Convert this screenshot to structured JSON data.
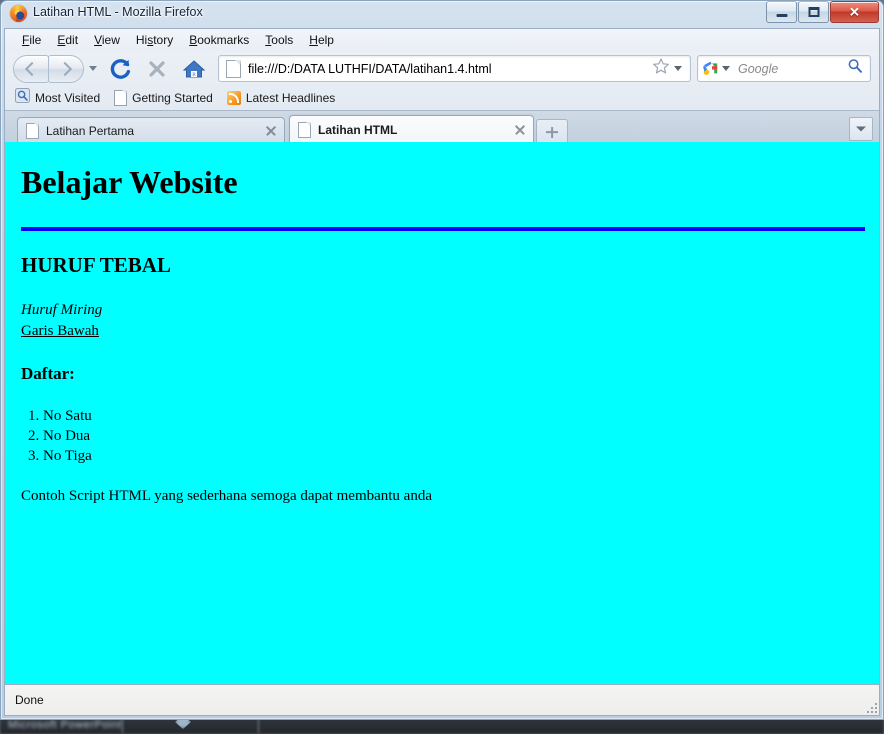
{
  "window": {
    "title": "Latihan HTML - Mozilla Firefox",
    "icon": "firefox-logo-icon",
    "controls": {
      "minimize": "minimize-button",
      "maximize": "maximize-button",
      "close": "close-button",
      "close_glyph": "✕"
    }
  },
  "menu": {
    "items": [
      {
        "label": "File",
        "accel": "F"
      },
      {
        "label": "Edit",
        "accel": "E"
      },
      {
        "label": "View",
        "accel": "V"
      },
      {
        "label": "History",
        "accel": "s"
      },
      {
        "label": "Bookmarks",
        "accel": "B"
      },
      {
        "label": "Tools",
        "accel": "T"
      },
      {
        "label": "Help",
        "accel": "H"
      }
    ]
  },
  "toolbar": {
    "back": "Back",
    "forward": "Forward",
    "reload": "Reload",
    "stop": "Stop",
    "home": "Home",
    "url": "file:///D:/DATA LUTHFI/DATA/latihan1.4.html",
    "bookmark_star": "☆",
    "search_placeholder": "Google",
    "search_value": ""
  },
  "bookmarks": {
    "items": [
      {
        "label": "Most Visited",
        "icon": "magnifier-icon"
      },
      {
        "label": "Getting Started",
        "icon": "page-icon"
      },
      {
        "label": "Latest Headlines",
        "icon": "rss-icon"
      }
    ]
  },
  "tabs": {
    "items": [
      {
        "label": "Latihan Pertama",
        "active": false
      },
      {
        "label": "Latihan HTML",
        "active": true
      }
    ],
    "new_tab": "+",
    "list_all": "list-all-tabs"
  },
  "page": {
    "background_color": "#00ffff",
    "rule_color": "#0000ff",
    "heading1": "Belajar Website",
    "heading3": "HURUF TEBAL",
    "italic_text": "Huruf Miring",
    "underline_text": "Garis Bawah",
    "list_heading": "Daftar:",
    "list_items": [
      "No Satu",
      "No Dua",
      "No Tiga"
    ],
    "paragraph": "Contoh Script HTML yang sederhana semoga dapat membantu anda"
  },
  "status": {
    "text": "Done"
  },
  "taskbar": {
    "ghost_text": "Microsoft PowerPoint"
  }
}
